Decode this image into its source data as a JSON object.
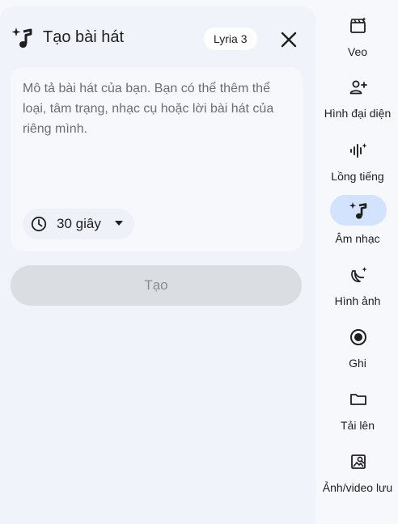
{
  "panel": {
    "title": "Tạo bài hát",
    "model_badge": "Lyria 3",
    "prompt_placeholder": "Mô tả bài hát của bạn. Bạn có thể thêm thể loại, tâm trạng, nhạc cụ hoặc lời bài hát của riêng mình.",
    "duration_label": "30 giây",
    "create_button": "Tạo"
  },
  "sidebar": {
    "items": [
      {
        "label": "Veo",
        "icon": "clapperboard-sparkle-icon",
        "active": false
      },
      {
        "label": "Hình đại diện",
        "icon": "person-add-icon",
        "active": false
      },
      {
        "label": "Lồng tiếng",
        "icon": "voice-wave-sparkle-icon",
        "active": false
      },
      {
        "label": "Âm nhạc",
        "icon": "music-note-sparkle-icon",
        "active": true
      },
      {
        "label": "Hình ảnh",
        "icon": "banana-sparkle-icon",
        "active": false
      },
      {
        "label": "Ghi",
        "icon": "record-icon",
        "active": false
      },
      {
        "label": "Tải lên",
        "icon": "folder-icon",
        "active": false
      },
      {
        "label": "Ảnh/video lưu",
        "icon": "saved-media-icon",
        "active": false
      }
    ]
  },
  "colors": {
    "panel_bg": "#f0f3fa",
    "card_bg": "#f7f8fc",
    "active_nav": "#d3e3fd",
    "disabled_button": "#dadde2"
  }
}
